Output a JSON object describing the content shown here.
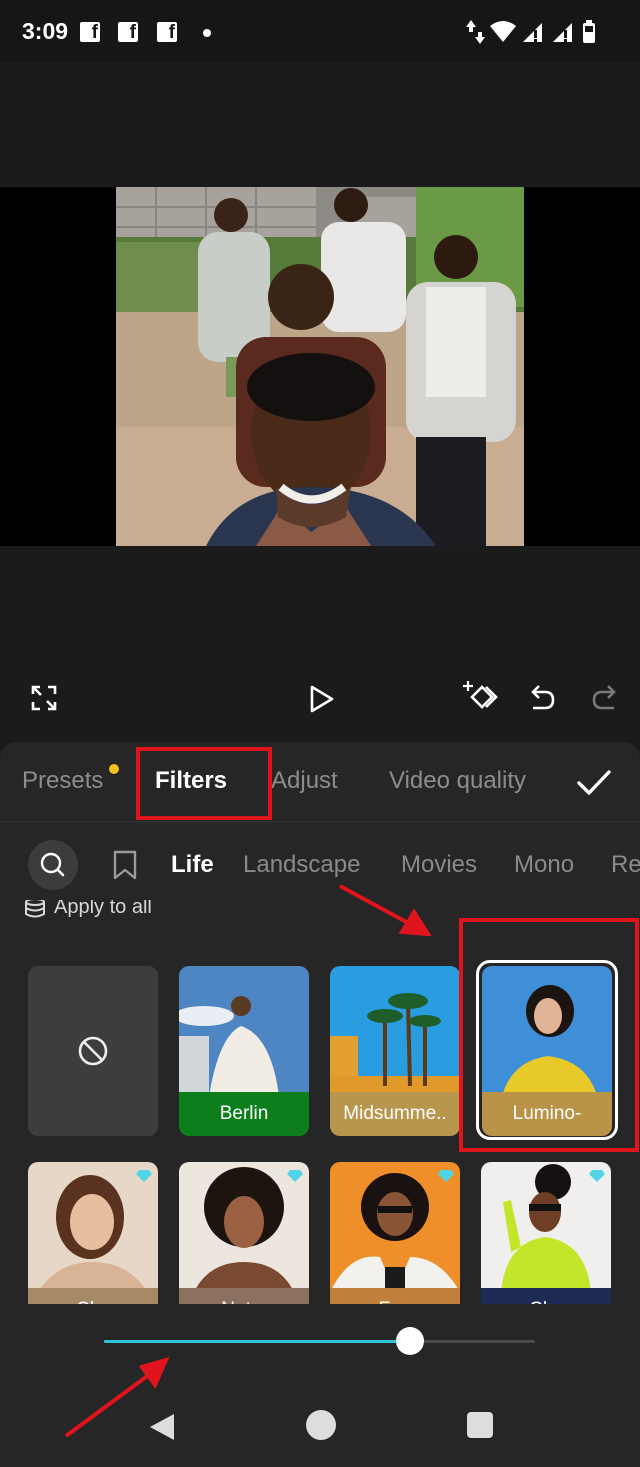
{
  "status": {
    "time": "3:09",
    "notification_icons": [
      "facebook-icon",
      "facebook-icon",
      "facebook-icon",
      "more-dot"
    ],
    "system_icons": [
      "data-arrows-icon",
      "wifi-icon",
      "signal-icon",
      "signal-icon",
      "battery-icon"
    ]
  },
  "editor": {
    "tools_left": [
      "fullscreen-icon"
    ],
    "tools_center": [
      "play-icon"
    ],
    "tools_right": [
      "add-keyframe-icon",
      "undo-icon",
      "redo-icon"
    ]
  },
  "tabs": {
    "items": [
      {
        "label": "Presets",
        "has_dot": true
      },
      {
        "label": "Filters",
        "active": true
      },
      {
        "label": "Adjust"
      },
      {
        "label": "Video quality"
      }
    ],
    "confirm_icon": "check-icon"
  },
  "categories": {
    "items": [
      "Life",
      "Landscape",
      "Movies",
      "Mono",
      "Re"
    ],
    "active": "Life"
  },
  "apply_all": "Apply to all",
  "filters_row1": [
    {
      "label": "",
      "kind": "none",
      "icon": "none-circle-slash-icon"
    },
    {
      "label": "Berlin",
      "label_color": "#0c7e1c"
    },
    {
      "label": "Midsumme..",
      "label_color": "#b8964e"
    },
    {
      "label": "Lumino-",
      "label_color": "#b89348",
      "selected": true
    }
  ],
  "filters_row2": [
    {
      "label": "Cl...",
      "label_color": "#a68a68",
      "premium": true
    },
    {
      "label": "Nat...",
      "label_color": "#8c7060",
      "premium": true
    },
    {
      "label": "Fr...",
      "label_color": "#c07f3a",
      "premium": true
    },
    {
      "label": "Cl...",
      "label_color": "#1e2c55",
      "premium": true
    }
  ],
  "intensity": {
    "value": 0.71
  },
  "colors": {
    "accent": "#2cc6d8",
    "highlight": "#e0141c",
    "panel": "#262626"
  }
}
